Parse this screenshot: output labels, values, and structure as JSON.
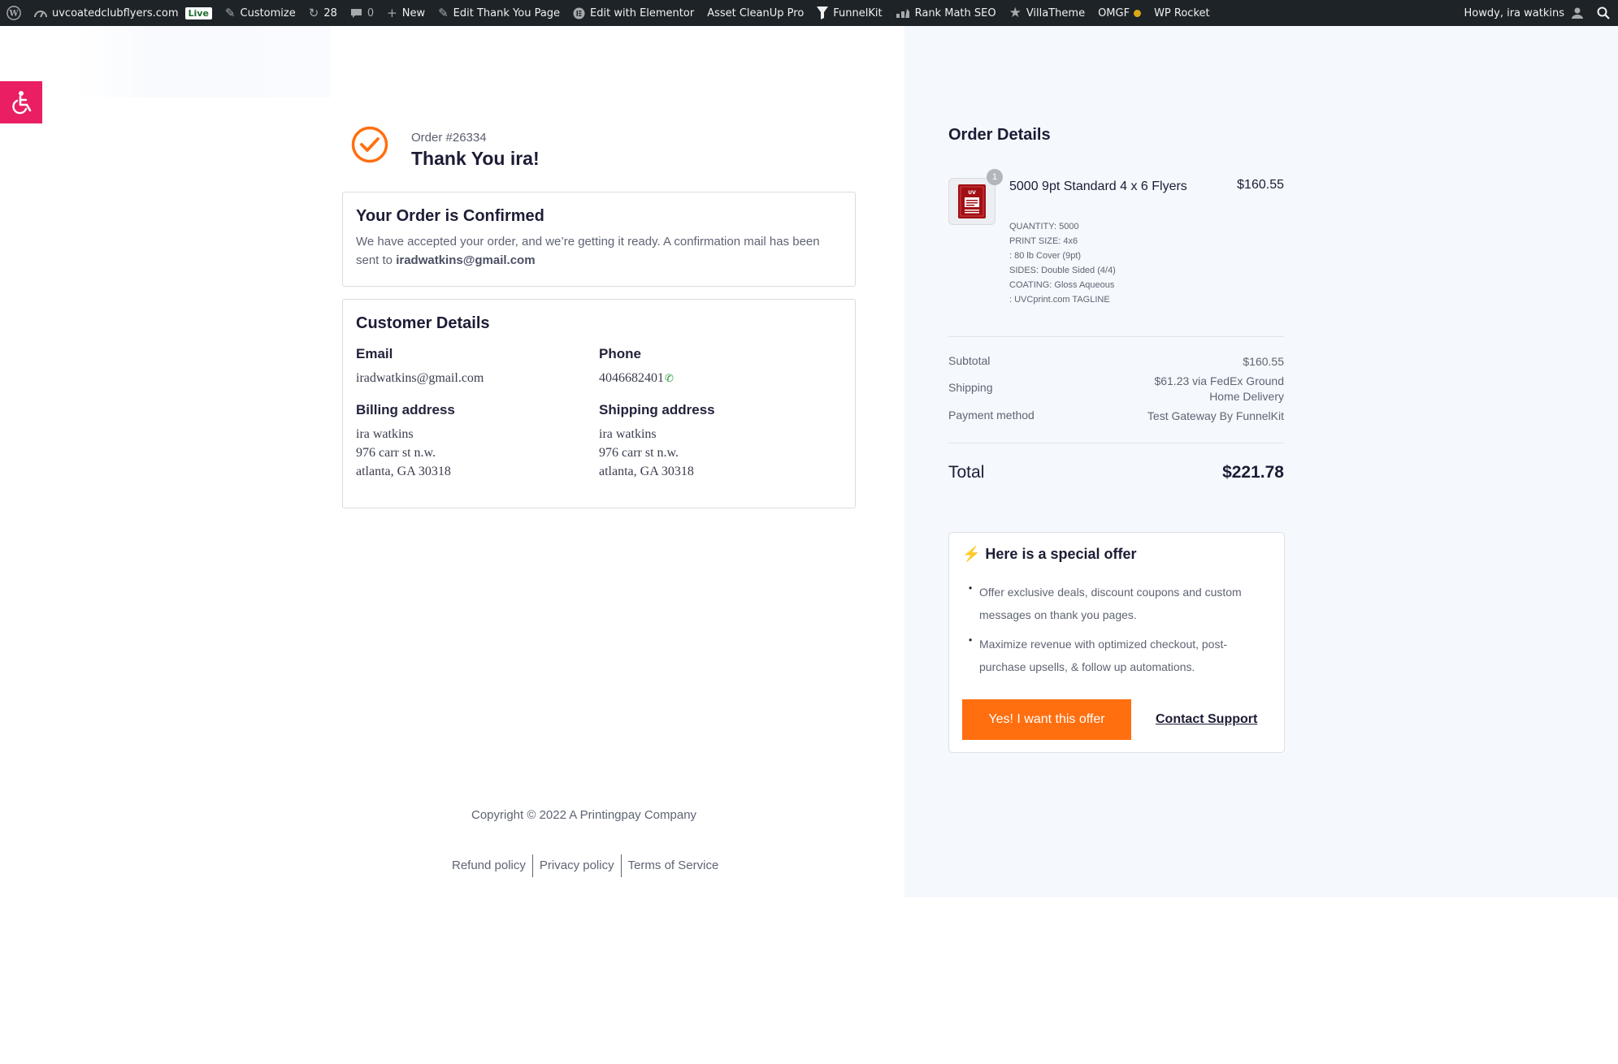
{
  "adminbar": {
    "site_name": "uvcoatedclubflyers.com",
    "live_badge": "Live",
    "customize": "Customize",
    "updates_count": "28",
    "comments_count": "0",
    "new": "New",
    "edit_page": "Edit Thank You Page",
    "elementor": "Edit with Elementor",
    "asset_cleanup": "Asset CleanUp Pro",
    "funnelkit": "FunnelKit",
    "rank_math": "Rank Math SEO",
    "villatheme": "VillaTheme",
    "omgf": "OMGF",
    "wp_rocket": "WP Rocket",
    "howdy": "Howdy, ira watkins"
  },
  "thankyou": {
    "order_number": "Order #26334",
    "title": "Thank You ira!"
  },
  "confirmation": {
    "title": "Your Order is Confirmed",
    "text": "We have accepted your order, and we’re getting it ready. A confirmation mail has been sent to ",
    "email": "iradwatkins@gmail.com"
  },
  "customer": {
    "title": "Customer Details",
    "email_label": "Email",
    "email": "iradwatkins@gmail.com",
    "phone_label": "Phone",
    "phone": "4046682401",
    "billing_label": "Billing address",
    "billing": [
      "ira watkins",
      "976 carr st n.w.",
      "atlanta, GA 30318"
    ],
    "shipping_label": "Shipping address",
    "shipping": [
      "ira watkins",
      "976 carr st n.w.",
      "atlanta, GA 30318"
    ]
  },
  "footer": {
    "copyright": "Copyright © 2022 A Printingpay Company",
    "links": [
      "Refund policy",
      "Privacy policy",
      "Terms of Service"
    ]
  },
  "order_details": {
    "title": "Order Details",
    "product": {
      "name": "5000 9pt Standard 4 x 6 Flyers",
      "price": "$160.55",
      "quantity_badge": "1",
      "thumb_text": "UV",
      "meta": [
        "QUANTITY: 5000",
        "PRINT SIZE: 4x6",
        ": 80 lb Cover (9pt)",
        "SIDES: Double Sided (4/4)",
        "COATING: Gloss Aqueous",
        ": UVCprint.com TAGLINE"
      ]
    },
    "subtotal_label": "Subtotal",
    "subtotal": "$160.55",
    "shipping_label": "Shipping",
    "shipping_line1": "$61.23 via FedEx Ground",
    "shipping_line2": "Home Delivery",
    "payment_label": "Payment method",
    "payment": "Test Gateway By FunnelKit",
    "total_label": "Total",
    "total": "$221.78"
  },
  "offer": {
    "title": "Here is a special offer",
    "bullets": [
      "Offer exclusive deals, discount coupons and custom messages on thank you pages.",
      "Maximize revenue with optimized checkout, post-purchase upsells, & follow up automations."
    ],
    "button": "Yes! I want this offer",
    "contact": "Contact Support"
  },
  "colors": {
    "accent_orange": "#ff6f0f",
    "admin_bar": "#1d2327",
    "a11y_button": "#e91e63",
    "right_panel_bg": "#f5f8fc"
  }
}
